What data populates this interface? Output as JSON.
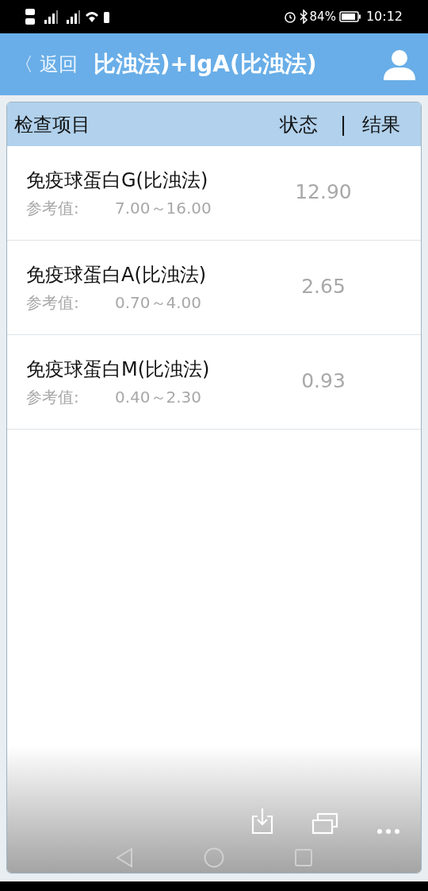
{
  "status_bar": {
    "battery": "84%",
    "time": "10:12"
  },
  "header": {
    "back": "〈 返回",
    "title": "比浊法)+IgA(比浊法)"
  },
  "table": {
    "columns": [
      "检查项目",
      "状态",
      "|",
      "结果"
    ],
    "rows": [
      {
        "name": "免疫球蛋白G(比浊法)",
        "ref_label": "参考值:",
        "ref_range": "7.00～16.00",
        "result": "12.90"
      },
      {
        "name": "免疫球蛋白A(比浊法)",
        "ref_label": "参考值:",
        "ref_range": "0.70～4.00",
        "result": "2.65"
      },
      {
        "name": "免疫球蛋白M(比浊法)",
        "ref_label": "参考值:",
        "ref_range": "0.40～2.30",
        "result": "0.93"
      }
    ]
  }
}
